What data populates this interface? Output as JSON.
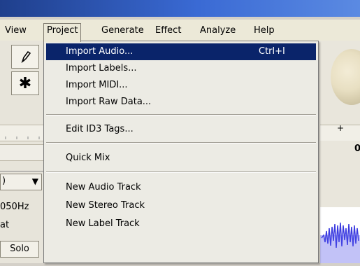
{
  "menubar": {
    "items": [
      "View",
      "Project",
      "Generate",
      "Effect",
      "Analyze",
      "Help"
    ]
  },
  "tools": {
    "draw": "draw-tool-icon",
    "multi": "multi-tool-icon",
    "multi_glyph": "✱"
  },
  "track": {
    "dropdown_glyph": "▼",
    "rate": "050Hz",
    "format": "at",
    "solo_label": "Solo"
  },
  "right_panel": {
    "ruler_label": "0",
    "tick_label": "+"
  },
  "project_menu": {
    "items": [
      {
        "label": "Import Audio...",
        "shortcut": "Ctrl+I"
      },
      {
        "label": "Import Labels..."
      },
      {
        "label": "Import MIDI..."
      },
      {
        "label": "Import Raw Data..."
      },
      {
        "label": "Edit ID3 Tags..."
      },
      {
        "label": "Quick Mix"
      },
      {
        "label": "New Audio Track"
      },
      {
        "label": "New Stereo Track"
      },
      {
        "label": "New Label Track"
      }
    ]
  },
  "colors": {
    "title_bar": "#2f5cb8",
    "highlight": "#0a246a",
    "waveform": "#3b3be0"
  }
}
